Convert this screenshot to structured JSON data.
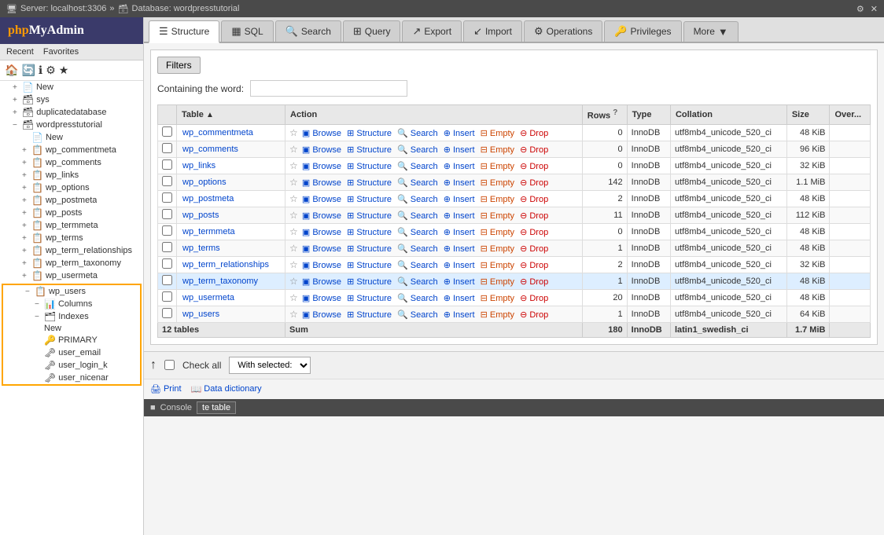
{
  "topbar": {
    "server": "Server: localhost:3306",
    "arrow": "»",
    "database": "Database: wordpresstutorial"
  },
  "logo": "phpMyAdmin",
  "sidebar": {
    "recent_label": "Recent",
    "favorites_label": "Favorites",
    "new_label": "New",
    "databases": [
      {
        "name": "sys",
        "indent": 1
      },
      {
        "name": "duplicatedatabase",
        "indent": 1
      },
      {
        "name": "wordpresstutorial",
        "indent": 1,
        "expanded": true
      }
    ],
    "wp_tables": [
      "wp_commentmeta",
      "wp_comments",
      "wp_links",
      "wp_options",
      "wp_postmeta",
      "wp_posts",
      "wp_termmeta",
      "wp_terms",
      "wp_term_relationships",
      "wp_term_taxonomy",
      "wp_usermeta",
      "wp_users"
    ],
    "wp_users_tree": {
      "label": "wp_users",
      "columns_label": "Columns",
      "indexes_label": "Indexes",
      "new_label": "New",
      "indexes": [
        "PRIMARY",
        "user_email",
        "user_login_k",
        "user_nicena"
      ]
    }
  },
  "tabs": [
    {
      "id": "structure",
      "label": "Structure",
      "icon": "☰",
      "active": true
    },
    {
      "id": "sql",
      "label": "SQL",
      "icon": "▦"
    },
    {
      "id": "search",
      "label": "Search",
      "icon": "🔍"
    },
    {
      "id": "query",
      "label": "Query",
      "icon": "?"
    },
    {
      "id": "export",
      "label": "Export",
      "icon": "↗"
    },
    {
      "id": "import",
      "label": "Import",
      "icon": "↙"
    },
    {
      "id": "operations",
      "label": "Operations",
      "icon": "⚙"
    },
    {
      "id": "privileges",
      "label": "Privileges",
      "icon": "🔑"
    },
    {
      "id": "more",
      "label": "More",
      "icon": "▼"
    }
  ],
  "filters": {
    "btn_label": "Filters",
    "containing_label": "Containing the word:",
    "placeholder": ""
  },
  "table": {
    "headers": {
      "table": "Table",
      "action": "Action",
      "rows": "Rows",
      "rows_help": "?",
      "type": "Type",
      "collation": "Collation",
      "size": "Size",
      "overhead": "Over..."
    },
    "rows": [
      {
        "name": "wp_commentmeta",
        "rows": "0",
        "type": "InnoDB",
        "collation": "utf8mb4_unicode_520_ci",
        "size": "48 KiB",
        "active": false
      },
      {
        "name": "wp_comments",
        "rows": "0",
        "type": "InnoDB",
        "collation": "utf8mb4_unicode_520_ci",
        "size": "96 KiB",
        "active": false
      },
      {
        "name": "wp_links",
        "rows": "0",
        "type": "InnoDB",
        "collation": "utf8mb4_unicode_520_ci",
        "size": "32 KiB",
        "active": false
      },
      {
        "name": "wp_options",
        "rows": "142",
        "type": "InnoDB",
        "collation": "utf8mb4_unicode_520_ci",
        "size": "1.1 MiB",
        "active": false
      },
      {
        "name": "wp_postmeta",
        "rows": "2",
        "type": "InnoDB",
        "collation": "utf8mb4_unicode_520_ci",
        "size": "48 KiB",
        "active": false
      },
      {
        "name": "wp_posts",
        "rows": "11",
        "type": "InnoDB",
        "collation": "utf8mb4_unicode_520_ci",
        "size": "112 KiB",
        "active": false
      },
      {
        "name": "wp_termmeta",
        "rows": "0",
        "type": "InnoDB",
        "collation": "utf8mb4_unicode_520_ci",
        "size": "48 KiB",
        "active": false
      },
      {
        "name": "wp_terms",
        "rows": "1",
        "type": "InnoDB",
        "collation": "utf8mb4_unicode_520_ci",
        "size": "48 KiB",
        "active": false
      },
      {
        "name": "wp_term_relationships",
        "rows": "2",
        "type": "InnoDB",
        "collation": "utf8mb4_unicode_520_ci",
        "size": "32 KiB",
        "active": false
      },
      {
        "name": "wp_term_taxonomy",
        "rows": "1",
        "type": "InnoDB",
        "collation": "utf8mb4_unicode_520_ci",
        "size": "48 KiB",
        "active": true
      },
      {
        "name": "wp_usermeta",
        "rows": "20",
        "type": "InnoDB",
        "collation": "utf8mb4_unicode_520_ci",
        "size": "48 KiB",
        "active": false
      },
      {
        "name": "wp_users",
        "rows": "1",
        "type": "InnoDB",
        "collation": "utf8mb4_unicode_520_ci",
        "size": "64 KiB",
        "active": false
      }
    ],
    "footer": {
      "label": "12 tables",
      "sum_label": "Sum",
      "total_rows": "180",
      "type": "InnoDB",
      "collation": "latin1_swedish_ci",
      "size": "1.7 MiB"
    },
    "actions": [
      "Browse",
      "Structure",
      "Search",
      "Insert",
      "Empty",
      "Drop"
    ]
  },
  "bottom": {
    "check_all_label": "Check all",
    "with_selected_label": "With selected:",
    "up_arrow": "↑"
  },
  "links": {
    "print_label": "Print",
    "data_dict_label": "Data dictionary"
  },
  "console": {
    "label": "Console",
    "create_table_label": "te table"
  }
}
